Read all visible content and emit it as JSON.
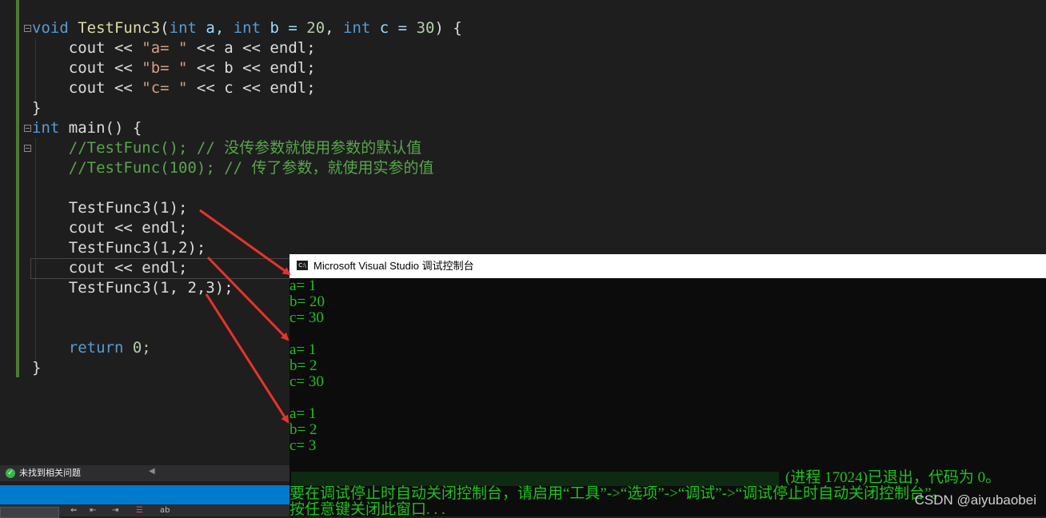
{
  "code": {
    "func_sig": {
      "kw_void": "void",
      "fname": "TestFunc3",
      "p1_kw": "int",
      "p1": " a, ",
      "p2_kw": "int",
      "p2": " b = ",
      "p2_val": "20",
      "sep": ", ",
      "p3_kw": "int",
      "p3": " c = ",
      "p3_val": "30",
      "tail": ") {"
    },
    "lines": [
      {
        "pre": "    cout << ",
        "str": "\"a= \"",
        "post": " << a << endl;"
      },
      {
        "pre": "    cout << ",
        "str": "\"b= \"",
        "post": " << b << endl;"
      },
      {
        "pre": "    cout << ",
        "str": "\"c= \"",
        "post": " << c << endl;"
      }
    ],
    "close_brace": "}",
    "main_kw": "int",
    "main_rest": " main() {",
    "comment1": "    //TestFunc(); // 没传参数就使用参数的默认值",
    "comment2": "    //TestFunc(100); // 传了参数，就使用实参的值",
    "call1": "    TestFunc3(1);",
    "endl1": "    cout << endl;",
    "call2": "    TestFunc3(1,2);",
    "endl2": "    cout << endl;",
    "call3": "    TestFunc3(1, 2,3);",
    "ret_kw": "    return",
    "ret_val": " 0;",
    "end_brace": "}"
  },
  "console": {
    "icon_label": "C:\\",
    "title": "Microsoft Visual Studio 调试控制台",
    "output": [
      "a= 1",
      "b= 20",
      "c= 30",
      "",
      "a= 1",
      "b= 2",
      "c= 30",
      "",
      "a= 1",
      "b= 2",
      "c= 3"
    ],
    "exit_line": "(进程 17024)已退出，代码为 0。",
    "hint_line": "要在调试停止时自动关闭控制台，请启用“工具”->“选项”->“调试”->“调试停止时自动关闭控制台”。",
    "close_line": "按任意键关闭此窗口. . ."
  },
  "status": {
    "issues_text": "未找到相关问题"
  },
  "watermark": "CSDN @aiyubaobei",
  "colors": {
    "arrow": "#e8322d",
    "console_text": "#1ec21e",
    "accent_blue": "#007acc"
  }
}
